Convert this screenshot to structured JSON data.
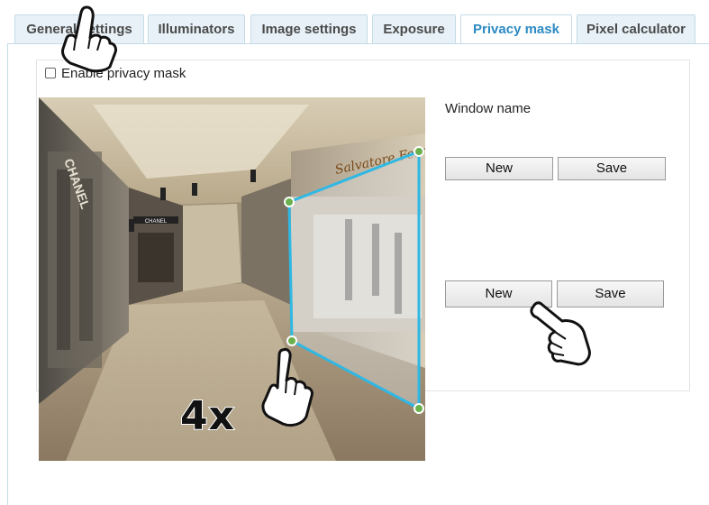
{
  "tabs": [
    {
      "label": "General settings",
      "active": false
    },
    {
      "label": "Illuminators",
      "active": false
    },
    {
      "label": "Image settings",
      "active": false
    },
    {
      "label": "Exposure",
      "active": false
    },
    {
      "label": "Privacy mask",
      "active": true
    },
    {
      "label": "Pixel calculator",
      "active": false
    }
  ],
  "privacy": {
    "enable_label": "Enable privacy mask",
    "enabled": false,
    "window_name_label": "Window name",
    "new_label": "New",
    "save_label": "Save"
  },
  "scene": {
    "sign_left": "CHANEL",
    "sign_mid": "CHANEL",
    "sign_store": "Salvatore Ferragamo"
  },
  "overlay": {
    "speed_label": "4x"
  },
  "colors": {
    "tab_active_text": "#2c8ac4",
    "mask_outline": "#2fb8e3",
    "mask_handle": "#6ab04c"
  }
}
